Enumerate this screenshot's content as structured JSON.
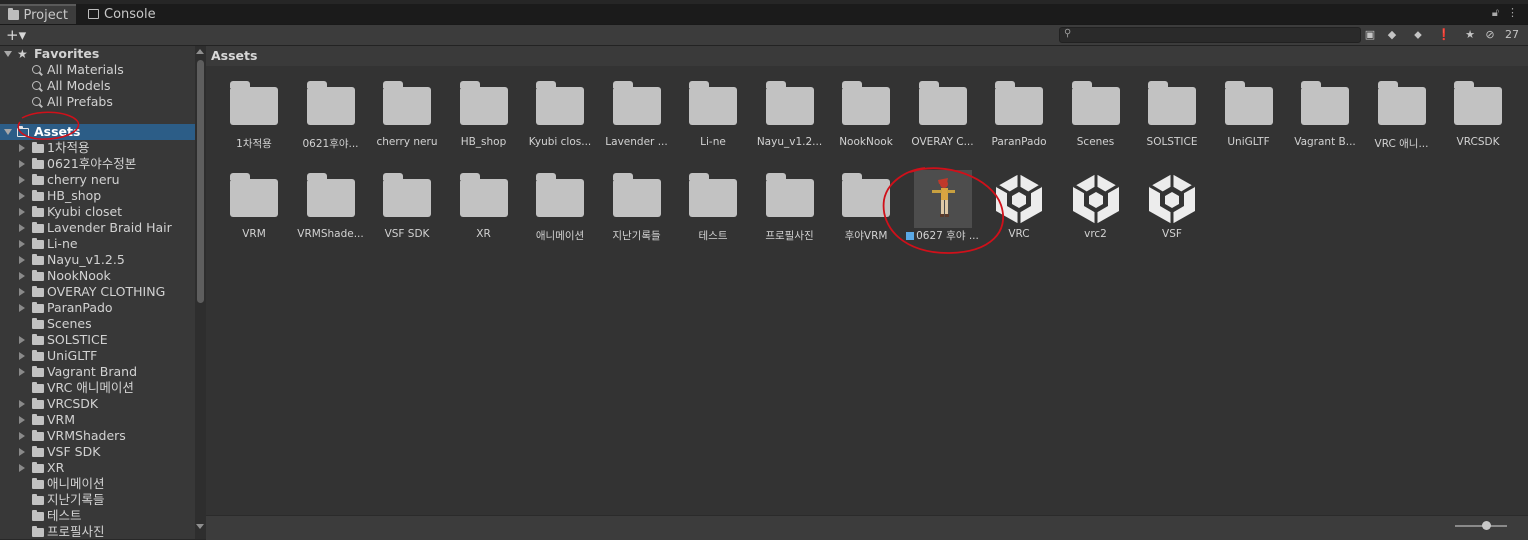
{
  "tabs": [
    {
      "label": "Project",
      "icon": "folder-icon",
      "active": true
    },
    {
      "label": "Console",
      "icon": "console-icon",
      "active": false
    }
  ],
  "toolbar": {
    "create_label": "+▾",
    "search_value": "",
    "hidden_count": "27"
  },
  "favorites": {
    "label": "Favorites",
    "items": [
      "All Materials",
      "All Models",
      "All Prefabs"
    ]
  },
  "tree": {
    "root_label": "Assets",
    "items": [
      {
        "label": "1차적용",
        "expandable": true
      },
      {
        "label": "0621후야수정본",
        "expandable": true
      },
      {
        "label": "cherry neru",
        "expandable": true
      },
      {
        "label": "HB_shop",
        "expandable": true
      },
      {
        "label": "Kyubi closet",
        "expandable": true
      },
      {
        "label": "Lavender Braid Hair",
        "expandable": true
      },
      {
        "label": "Li-ne",
        "expandable": true
      },
      {
        "label": "Nayu_v1.2.5",
        "expandable": true
      },
      {
        "label": "NookNook",
        "expandable": true
      },
      {
        "label": "OVERAY CLOTHING",
        "expandable": true
      },
      {
        "label": "ParanPado",
        "expandable": true
      },
      {
        "label": "Scenes",
        "expandable": false
      },
      {
        "label": "SOLSTICE",
        "expandable": true
      },
      {
        "label": "UniGLTF",
        "expandable": true
      },
      {
        "label": "Vagrant Brand",
        "expandable": true
      },
      {
        "label": "VRC 애니메이션",
        "expandable": false
      },
      {
        "label": "VRCSDK",
        "expandable": true
      },
      {
        "label": "VRM",
        "expandable": true
      },
      {
        "label": "VRMShaders",
        "expandable": true
      },
      {
        "label": "VSF SDK",
        "expandable": true
      },
      {
        "label": "XR",
        "expandable": true
      },
      {
        "label": "애니메이션",
        "expandable": false
      },
      {
        "label": "지난기록들",
        "expandable": false
      },
      {
        "label": "테스트",
        "expandable": false
      },
      {
        "label": "프로필사진",
        "expandable": false
      }
    ]
  },
  "breadcrumb": "Assets",
  "grid_items": [
    {
      "label": "1차적용",
      "kind": "folder"
    },
    {
      "label": "0621후야...",
      "kind": "folder"
    },
    {
      "label": "cherry neru",
      "kind": "folder"
    },
    {
      "label": "HB_shop",
      "kind": "folder"
    },
    {
      "label": "Kyubi clos...",
      "kind": "folder"
    },
    {
      "label": "Lavender ...",
      "kind": "folder"
    },
    {
      "label": "Li-ne",
      "kind": "folder"
    },
    {
      "label": "Nayu_v1.2...",
      "kind": "folder"
    },
    {
      "label": "NookNook",
      "kind": "folder"
    },
    {
      "label": "OVERAY C...",
      "kind": "folder"
    },
    {
      "label": "ParanPado",
      "kind": "folder"
    },
    {
      "label": "Scenes",
      "kind": "folder"
    },
    {
      "label": "SOLSTICE",
      "kind": "folder"
    },
    {
      "label": "UniGLTF",
      "kind": "folder"
    },
    {
      "label": "Vagrant B...",
      "kind": "folder"
    },
    {
      "label": "VRC 애니...",
      "kind": "folder"
    },
    {
      "label": "VRCSDK",
      "kind": "folder"
    },
    {
      "label": "VRM",
      "kind": "folder"
    },
    {
      "label": "VRMShade...",
      "kind": "folder"
    },
    {
      "label": "VSF SDK",
      "kind": "folder"
    },
    {
      "label": "XR",
      "kind": "folder"
    },
    {
      "label": "애니메이션",
      "kind": "folder"
    },
    {
      "label": "지난기록들",
      "kind": "folder"
    },
    {
      "label": "테스트",
      "kind": "folder"
    },
    {
      "label": "프로필사진",
      "kind": "folder"
    },
    {
      "label": "후야VRM",
      "kind": "folder"
    },
    {
      "label": "0627 후야 ...",
      "kind": "prefab"
    },
    {
      "label": "VRC",
      "kind": "unity"
    },
    {
      "label": "vrc2",
      "kind": "unity"
    },
    {
      "label": "VSF",
      "kind": "unity"
    }
  ],
  "colors": {
    "selection": "#2c5d87",
    "annotation": "#d0101a"
  }
}
